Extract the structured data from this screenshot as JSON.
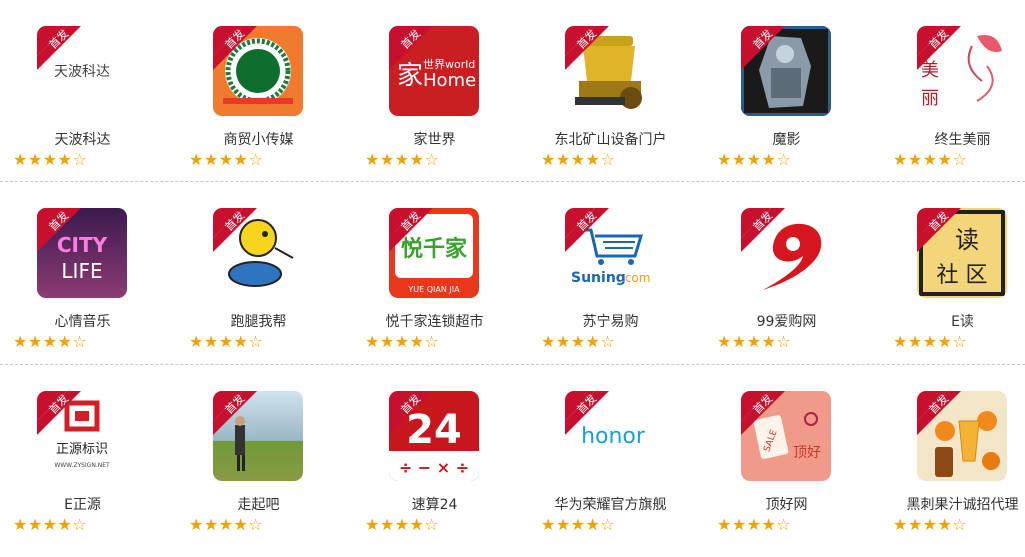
{
  "badge_text": "首发",
  "colors": {
    "badge": "#c8102e",
    "star": "#f2a200",
    "text": "#333333",
    "divider": "#c8c8c8"
  },
  "rows": [
    {
      "apps": [
        {
          "name": "天波科达",
          "icon": "tianbo-placeholder-icon",
          "icon_text": "天波科达",
          "rating": 4
        },
        {
          "name": "商贸小传媒",
          "icon": "wreath-logo-icon",
          "rating": 4
        },
        {
          "name": "家世界",
          "icon": "home-world-logo-icon",
          "icon_text": "世界world Home",
          "rating": 4
        },
        {
          "name": "东北矿山设备门户",
          "icon": "crusher-machine-icon",
          "rating": 4
        },
        {
          "name": "魔影",
          "icon": "robot-warrior-icon",
          "rating": 4
        },
        {
          "name": "终生美丽",
          "icon": "flower-beauty-icon",
          "icon_text": "美丽",
          "rating": 4
        }
      ]
    },
    {
      "apps": [
        {
          "name": "心情音乐",
          "icon": "city-life-neon-icon",
          "icon_text": "CITY LIFE",
          "rating": 4
        },
        {
          "name": "跑腿我帮",
          "icon": "yellow-runner-icon",
          "rating": 4
        },
        {
          "name": "悦千家连锁超市",
          "icon": "yue-qian-jia-logo-icon",
          "icon_text": "悦千家 YUE QIAN JIA",
          "rating": 4
        },
        {
          "name": "苏宁易购",
          "icon": "suning-cart-icon",
          "icon_text": "Suning.com",
          "rating": 4
        },
        {
          "name": "99爱购网",
          "icon": "red-nine-logo-icon",
          "rating": 4
        },
        {
          "name": "E读",
          "icon": "reading-club-icon",
          "icon_text": "读 社 区",
          "rating": 4
        }
      ]
    },
    {
      "apps": [
        {
          "name": "E正源",
          "icon": "zhengyuan-sign-icon",
          "icon_text": "正源标识 WWW.ZYSIGN.NET",
          "rating": 4
        },
        {
          "name": "走起吧",
          "icon": "hiker-mountain-icon",
          "rating": 4
        },
        {
          "name": "速算24",
          "icon": "math-24-icon",
          "icon_text": "24 ÷ − × ÷",
          "rating": 4
        },
        {
          "name": "华为荣耀官方旗舰",
          "icon": "honor-logo-icon",
          "icon_text": "honor",
          "rating": 4
        },
        {
          "name": "顶好网",
          "icon": "sale-tag-icon",
          "icon_text": "SALE 顶好",
          "rating": 4
        },
        {
          "name": "黑刺果汁诚招代理",
          "icon": "juice-glass-icon",
          "rating": 4
        }
      ]
    }
  ]
}
